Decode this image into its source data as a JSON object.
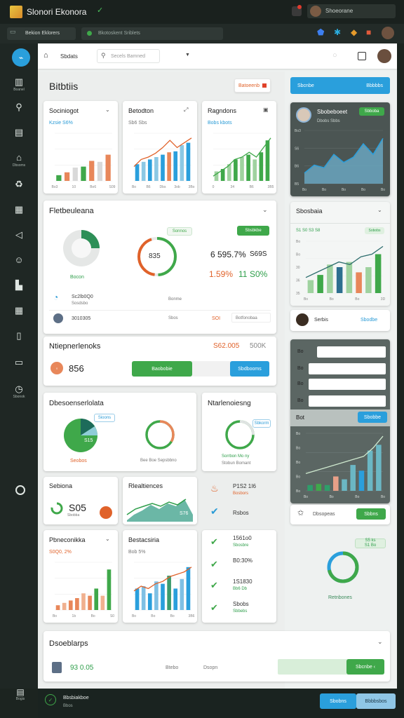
{
  "app": {
    "title": "Slonori Ekonora"
  },
  "titlebar": {
    "user_name": "Shoeorane"
  },
  "toolbar": {
    "breadcrumb": "Bekion Eklorers",
    "url": "Bkotoskent Sriblets"
  },
  "header": {
    "tab_label": "Sbdats",
    "search_placeholder": "Secels Bamned"
  },
  "sidebar": {
    "items": [
      {
        "icon": "briefcase-icon",
        "label": "Boanel"
      },
      {
        "icon": "search-icon",
        "label": ""
      },
      {
        "icon": "document-icon",
        "label": ""
      },
      {
        "icon": "home-icon",
        "label": "Dbsoms"
      },
      {
        "icon": "recycle-icon",
        "label": ""
      },
      {
        "icon": "chart-icon",
        "label": ""
      },
      {
        "icon": "megaphone-icon",
        "label": ""
      },
      {
        "icon": "smile-icon",
        "label": ""
      },
      {
        "icon": "building-icon",
        "label": ""
      },
      {
        "icon": "grid-icon",
        "label": ""
      },
      {
        "icon": "book-icon",
        "label": ""
      },
      {
        "icon": "wallet-icon",
        "label": ""
      },
      {
        "icon": "stopwatch-icon",
        "label": "Sbonok"
      }
    ],
    "bottom_label": "Bogis"
  },
  "main": {
    "title": "Bitbtiis",
    "title_button": "Batoeenb",
    "cards_row1": [
      {
        "title": "Sociniogot",
        "subtitle": "Kzsie S6%",
        "chart": "bars-mixed",
        "ticks": [
          "Bo3",
          "10",
          "Bo6",
          "S09"
        ]
      },
      {
        "title": "Betodton",
        "subtitle": "Sb6 Sbs",
        "chart": "bars-line",
        "ticks": [
          "Bo",
          "B6",
          "Dbs",
          "3ob",
          "3Bo"
        ]
      },
      {
        "title": "Ragndons",
        "subtitle": "Bobs kbots",
        "chart": "bars-green",
        "ticks": [
          "0",
          "34",
          "B6",
          "3B5"
        ]
      }
    ],
    "perf": {
      "title": "Fletbeuleana",
      "pie_label": "Bocon",
      "donut_value": "835",
      "stat1_value": "6 595.7%",
      "stat1_extra": "S69S",
      "stat2_value": "1.59%",
      "stat2_mid": "11",
      "stat2_extra": "S0%",
      "tag_label": "Sonnos",
      "button_label": "Sbsbkbe",
      "rows": [
        {
          "title": "Sc2lb0Q0",
          "sub": "Sosdsbo",
          "mid": "Bonme",
          "right": ""
        },
        {
          "title": "3010305",
          "sub": "",
          "mid": "Sbos",
          "right": "SOI",
          "extra": "Botfonobaa"
        }
      ]
    },
    "summary": {
      "title": "Ntiepnerlenoks",
      "value1": "S62.005",
      "value2": "500K",
      "count": "856",
      "btn_green": "Baobobie",
      "btn_blue": "Sbdbooms"
    },
    "donuts": [
      {
        "title": "Dbesoenserlolata",
        "badge": "Sioons",
        "pie_value": "S15",
        "pie_sub": "Seobos"
      },
      {
        "title": "",
        "sub": "Bee Boe Sepsbbno",
        "badge": ""
      },
      {
        "title": "Ntarlenoiesng",
        "badge": "Sbkorm",
        "sub1": "Sorrbon Mo ny",
        "sub2": "Stobun Bomant"
      }
    ],
    "row4": [
      {
        "title": "Sebiona",
        "value": "S05",
        "sub": "Sbobba"
      },
      {
        "title": "Rlealtiences",
        "value": "S76"
      },
      {
        "items": [
          {
            "title": "P1S2 1I6",
            "sub": "Bosbors"
          },
          {
            "title": "Rsbos",
            "sub": ""
          }
        ]
      }
    ],
    "row5": [
      {
        "title": "Pbneconikka",
        "subtitle": "S0Q0, 2%",
        "ticks": [
          "Bo",
          "1b",
          "Bo",
          "S0"
        ]
      },
      {
        "title": "Bestacsiria",
        "subtitle": "Bob 5%",
        "ticks": [
          "Bo",
          "Bo",
          "Bo",
          "3B6"
        ]
      },
      {
        "checks": [
          {
            "title": "1561o0",
            "sub": "Sbosbre"
          },
          {
            "title": "B0:30%",
            "sub": ""
          },
          {
            "title": "1S1830",
            "sub": "Bb6 Db"
          },
          {
            "title": "Sbobs",
            "sub": "Sbbebs"
          }
        ]
      }
    ],
    "footer_card": {
      "title": "Dsoeblarps",
      "value": "93 0.05",
      "label1": "Btebo",
      "label2": "Dsopn",
      "btn": "Sbcnbe ‹"
    }
  },
  "right": {
    "top_button_left": "Sbcnbe",
    "top_button_right": "Bbbbbs",
    "profile": {
      "name": "Sbobeboeet",
      "sub": "Dbobs Sbbs",
      "badge": "Sbboba",
      "yticks": [
        "Bo3",
        "S6",
        "B6",
        "B5"
      ],
      "xticks": [
        "Bo",
        "Bo",
        "Bo",
        "Bo",
        "Bo"
      ]
    },
    "section": {
      "title": "Sbosbaia",
      "badge": "Sobobs",
      "badge2": "S1 S0 S3 S8",
      "yticks": [
        "Bo",
        "Bo",
        "30",
        "36",
        "35"
      ],
      "xticks": [
        "Bo",
        "Bo",
        "Bo",
        "3D"
      ]
    },
    "user": {
      "name": "Serbis",
      "link": "Sbodbe"
    },
    "form": {
      "labels": [
        "Bo",
        "Bo",
        "Bo",
        "Bo"
      ],
      "label_bold": "Bot",
      "button": "Sbobbe",
      "yticks": [
        "Bo",
        "Bo",
        "Bo",
        "Bo",
        "Bo"
      ],
      "xticks": [
        "Bo",
        "Bo",
        "Bo",
        "Bo"
      ]
    },
    "footer": {
      "label": "Dbsopeas",
      "btn": "Sbbns"
    },
    "ring": {
      "badge1": "S5 ks",
      "badge2": "S1 Bo",
      "label": "Retnbones"
    }
  },
  "statusbar": {
    "title": "Bbsbiakboe",
    "sub": "Bbos",
    "btn1": "Sbobns",
    "btn2": "Bbbbsbos"
  },
  "colors": {
    "green": "#3fa84a",
    "blue": "#2a9fdc",
    "orange": "#e8875a",
    "teal": "#6bb7c4",
    "dark": "#1c2420"
  }
}
